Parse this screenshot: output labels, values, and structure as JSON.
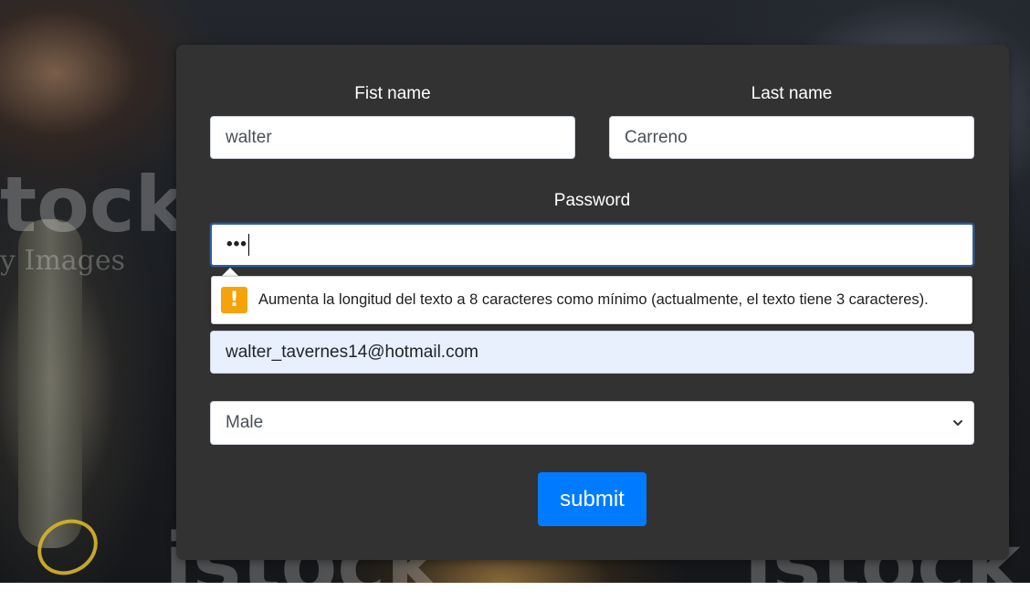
{
  "form": {
    "first_name": {
      "label": "Fist name",
      "value": "walter"
    },
    "last_name": {
      "label": "Last name",
      "value": "Carreno"
    },
    "password": {
      "label": "Password",
      "value_masked": "•••"
    },
    "validation_tooltip": {
      "icon": "warning-icon",
      "icon_glyph": "!",
      "message": "Aumenta la longitud del texto a 8 caracteres como mínimo (actualmente, el texto tiene 3 caracteres)."
    },
    "email": {
      "value": "walter_tavernes14@hotmail.com"
    },
    "gender": {
      "selected": "Male"
    },
    "submit_label": "submit"
  },
  "background": {
    "watermark_top": "tock",
    "watermark_sub": "y Images",
    "watermark_bottom_left": "istock",
    "watermark_bottom_right": "istock"
  },
  "colors": {
    "card_bg": "#323232",
    "submit_bg": "#007bff",
    "autofill_bg": "#e8f0fe",
    "warning": "#f5a30a",
    "focus_border": "#2f5d9c"
  }
}
